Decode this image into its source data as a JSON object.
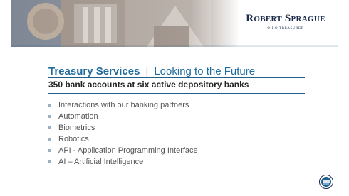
{
  "header": {
    "logo_name_first": "Robert Sprague",
    "logo_subtitle": "OHIO TREASURER"
  },
  "slide": {
    "title_main": "Treasury Services",
    "title_separator": "|",
    "title_secondary": "Looking to the Future",
    "subheading": "350 bank accounts at six active depository banks",
    "bullets": [
      "Interactions with our banking partners",
      "Automation",
      "Biometrics",
      "Robotics",
      "API - Application Programming Interface",
      "AI – Artificial Intelligence"
    ]
  },
  "colors": {
    "title_blue": "#1e6b9e",
    "rule_blue": "#1f5f8b",
    "brand_navy": "#1b2a4a",
    "bullet_marker": "#9ab0c4"
  },
  "icons": {
    "seal": "ohio-treasurer-seal-icon"
  }
}
